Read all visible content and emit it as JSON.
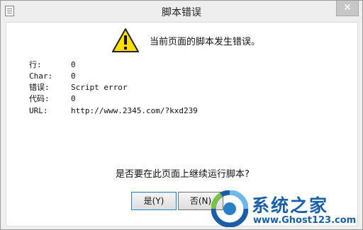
{
  "window": {
    "title": "脚本错误",
    "close_label": "✕"
  },
  "message": "当前页面的脚本发生错误。",
  "details": [
    {
      "label": "行:",
      "value": "0"
    },
    {
      "label": "Char:",
      "value": "0"
    },
    {
      "label": "错误:",
      "value": "Script error"
    },
    {
      "label": "代码:",
      "value": "0"
    },
    {
      "label": "URL:",
      "value": "http://www.2345.com/?kxd239"
    }
  ],
  "question": "是否要在此页面上继续运行脚本?",
  "buttons": {
    "yes": "是(Y)",
    "no": "否(N)"
  },
  "watermark": {
    "title": "系统之家",
    "url": "www.Ghost123.com"
  },
  "icons": {
    "app": "document-icon",
    "warning": "warning-icon",
    "watermark": "logo-icon"
  },
  "colors": {
    "warning_fill": "#ffe000",
    "watermark": "#1a5fa6"
  }
}
